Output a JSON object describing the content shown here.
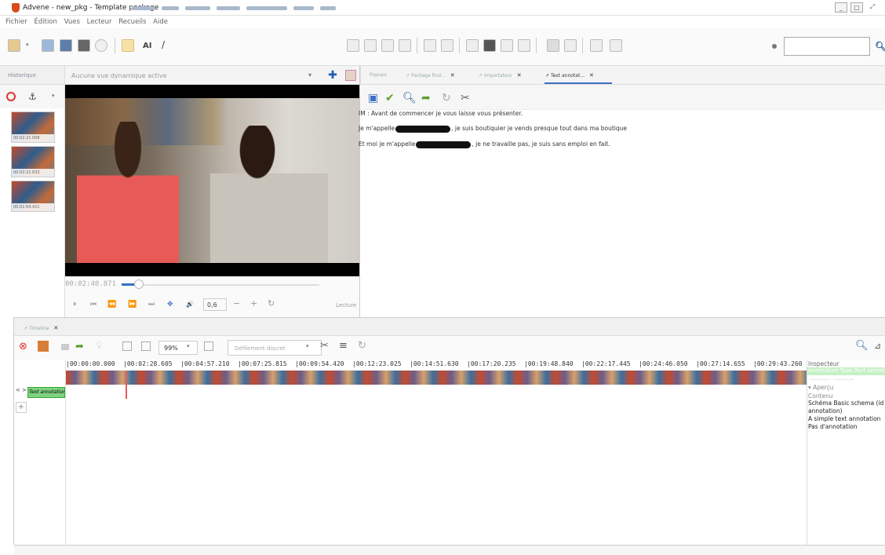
{
  "window": {
    "title": "Advene - new_pkg - Template package",
    "controls": [
      "_",
      "□",
      "⤢"
    ]
  },
  "menu": [
    "Fichier",
    "Édition",
    "Vues",
    "Lecteur",
    "Recueils",
    "Aide"
  ],
  "toolbar": {
    "ai_label": "AI",
    "search_placeholder": ""
  },
  "history": {
    "tab_label": "Historique",
    "snapshots": [
      {
        "time": "00:02:21.008"
      },
      {
        "time": "00:02:21.833"
      },
      {
        "time": "00:01:54.421"
      }
    ]
  },
  "player": {
    "dynamic_view": "Aucune vue dynamique active",
    "timecode": "00:02:40.871",
    "playback_rate": "0,6",
    "state": "Lecture",
    "controls": [
      "⏸",
      "⏮",
      "⏪",
      "⏩",
      "⏭",
      "✥",
      "🔊",
      "−",
      "+",
      "↻"
    ]
  },
  "right_tabs": [
    {
      "label": "Popups",
      "active": false
    },
    {
      "label": "Package find...",
      "active": false
    },
    {
      "label": "Importateur",
      "active": false
    },
    {
      "label": "Text annotat...",
      "active": true
    }
  ],
  "annotation_text": {
    "line1": "IM : Avant de commencer je vous laisse vous présenter.",
    "line2_pre": "Je m'appelle",
    "line2_post": ", je suis boutiquier je vends presque tout dans ma boutique",
    "line3_pre": "Et moi je m'appelle",
    "line3_post": ", je ne travaille pas, je suis sans emploi en fait."
  },
  "timeline": {
    "tab_label": "Timeline",
    "zoom": "99%",
    "scroll_mode": "Défilement discret",
    "ruler": [
      "|00:00:00.000",
      "|00:02:28.605",
      "|00:04:57.210",
      "|00:07:25.815",
      "|00:09:54.420",
      "|00:12:23.025",
      "|00:14:51.630",
      "|00:17:20.235",
      "|00:19:48.840",
      "|00:22:17.445",
      "|00:24:46.050",
      "|00:27:14.655",
      "|00:29:43.260"
    ],
    "track_nav": "< >",
    "track_name": "Text annotation",
    "add_track": "+"
  },
  "inspector": {
    "title": "Inspecteur",
    "type": "Annotation Type Text annotation",
    "dashes": "--:--:--.--- - --:--:--.---",
    "apercu": "▾ Aperçu",
    "contenu": "Contenu",
    "schema": "Schéma Basic schema (id annotation)",
    "description": "A simple text annotation",
    "status": "Pas d'annotation"
  },
  "colors": {
    "accent": "#3b6fc4",
    "track_green": "#7fd17f",
    "cursor_red": "#e65b5b"
  }
}
